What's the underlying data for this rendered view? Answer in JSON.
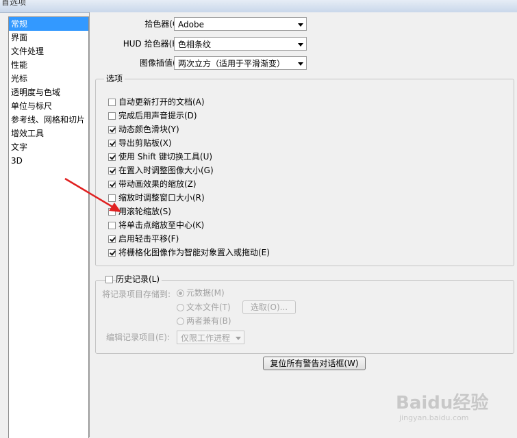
{
  "window": {
    "title": "首选项"
  },
  "categories": [
    "常规",
    "界面",
    "文件处理",
    "性能",
    "光标",
    "透明度与色域",
    "单位与标尺",
    "参考线、网格和切片",
    "增效工具",
    "文字",
    "3D"
  ],
  "general": {
    "color_picker": {
      "label": "拾色器(C):",
      "value": "Adobe"
    },
    "hud_picker": {
      "label": "HUD 拾色器(H):",
      "value": "色相条纹"
    },
    "interp": {
      "label": "图像插值(I):",
      "value": "两次立方（适用于平滑渐变）"
    }
  },
  "options": {
    "legend": "选项",
    "items": [
      {
        "label": "自动更新打开的文档(A)",
        "checked": false
      },
      {
        "label": "完成后用声音提示(D)",
        "checked": false
      },
      {
        "label": "动态颜色滑块(Y)",
        "checked": true
      },
      {
        "label": "导出剪贴板(X)",
        "checked": true
      },
      {
        "label": "使用 Shift 键切换工具(U)",
        "checked": true
      },
      {
        "label": "在置入时调整图像大小(G)",
        "checked": true
      },
      {
        "label": "带动画效果的缩放(Z)",
        "checked": true
      },
      {
        "label": "缩放时调整窗口大小(R)",
        "checked": false
      },
      {
        "label": "用滚轮缩放(S)",
        "checked": false
      },
      {
        "label": "将单击点缩放至中心(K)",
        "checked": false
      },
      {
        "label": "启用轻击平移(F)",
        "checked": true
      },
      {
        "label": "将栅格化图像作为智能对象置入或拖动(E)",
        "checked": true
      }
    ]
  },
  "history": {
    "legend": "历史记录(L)",
    "checked": false,
    "save_to_label": "将记录项目存储到:",
    "radios": [
      {
        "label": "元数据(M)",
        "selected": true
      },
      {
        "label": "文本文件(T)",
        "selected": false
      },
      {
        "label": "两者兼有(B)",
        "selected": false
      }
    ],
    "choose_button": "选取(O)...",
    "edit_log_label": "编辑记录项目(E):",
    "edit_log_value": "仅限工作进程"
  },
  "reset_button": "复位所有警告对话框(W)",
  "watermark": {
    "brand": "Baidu经验",
    "url": "jingyan.baidu.com"
  },
  "colors": {
    "selection": "#3399ff",
    "arrow": "#e02020"
  }
}
